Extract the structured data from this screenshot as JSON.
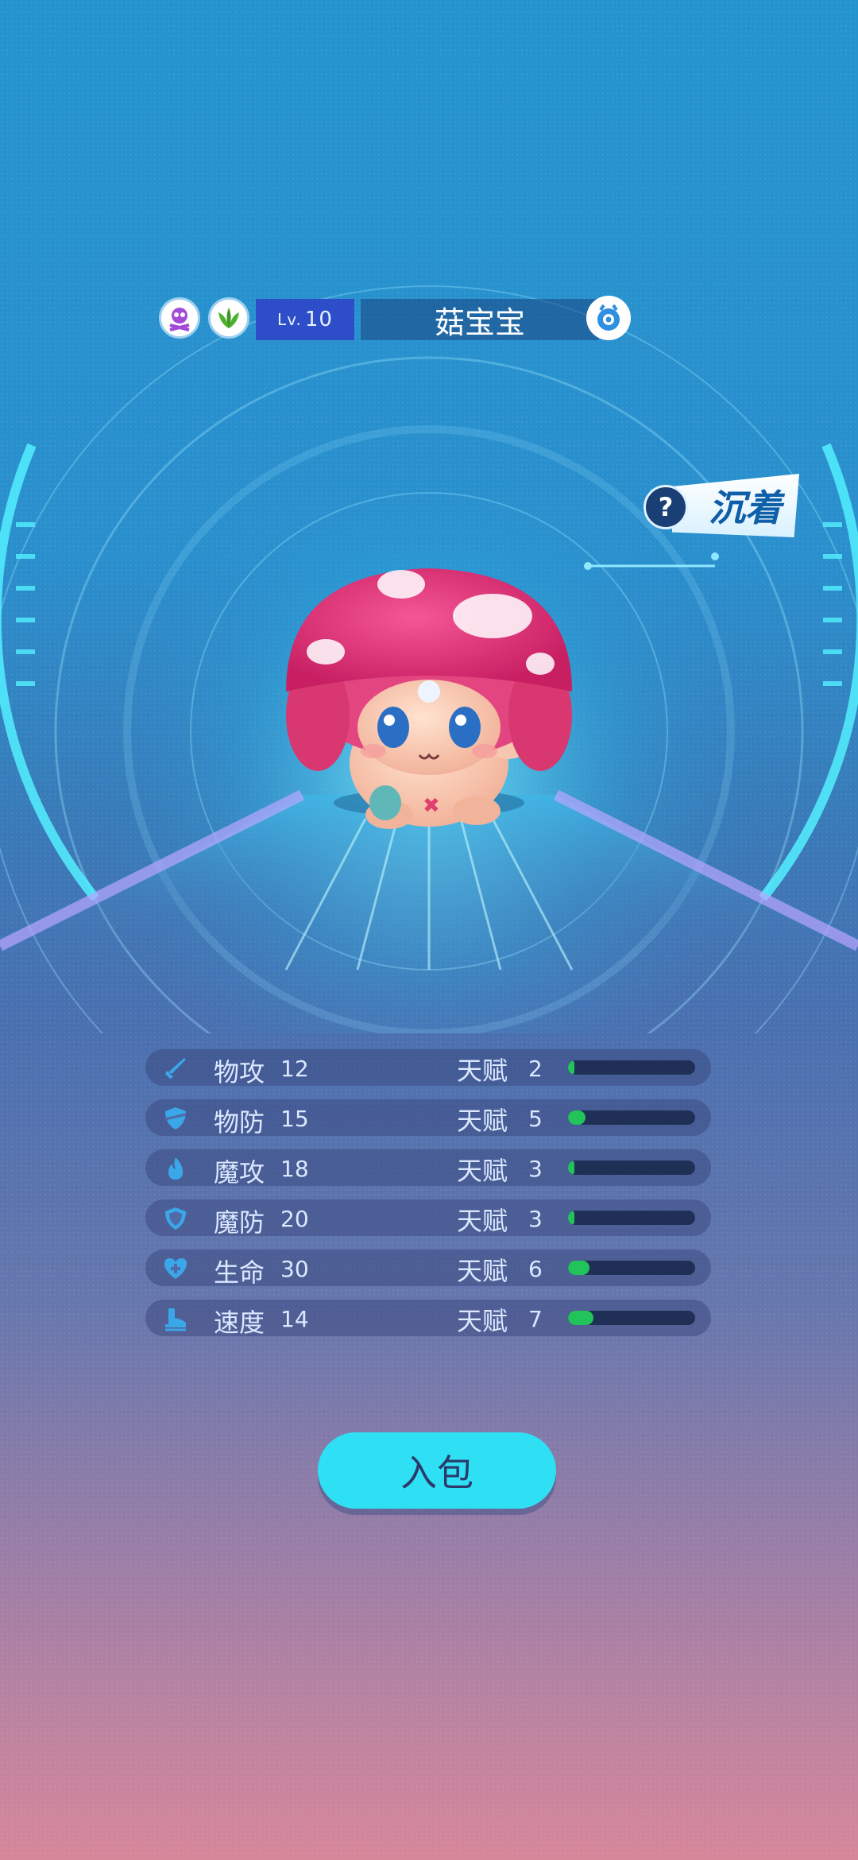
{
  "header": {
    "level_prefix": "Lv.",
    "level": "10",
    "pet_name": "菇宝宝",
    "type_badges": [
      "poison-skull-icon",
      "grass-leaf-icon"
    ],
    "gender_icon": "gender-icon"
  },
  "trait": {
    "label": "沉着",
    "help_symbol": "?"
  },
  "stats": [
    {
      "name": "物攻",
      "value": "12",
      "talent_label": "天赋",
      "talent": "2",
      "talent_fill": 0.05,
      "icon": "sword-icon"
    },
    {
      "name": "物防",
      "value": "15",
      "talent_label": "天赋",
      "talent": "5",
      "talent_fill": 0.14,
      "icon": "shield-icon"
    },
    {
      "name": "魔攻",
      "value": "18",
      "talent_label": "天赋",
      "talent": "3",
      "talent_fill": 0.05,
      "icon": "flame-icon"
    },
    {
      "name": "魔防",
      "value": "20",
      "talent_label": "天赋",
      "talent": "3",
      "talent_fill": 0.05,
      "icon": "magic-shield-icon"
    },
    {
      "name": "生命",
      "value": "30",
      "talent_label": "天赋",
      "talent": "6",
      "talent_fill": 0.17,
      "icon": "heart-plus-icon"
    },
    {
      "name": "速度",
      "value": "14",
      "talent_label": "天赋",
      "talent": "7",
      "talent_fill": 0.2,
      "icon": "boot-icon"
    }
  ],
  "bag_button": "入包",
  "colors": {
    "accent": "#2fe0f5",
    "level_bg": "#2e4dc8",
    "talent_bar": "#22c35b"
  }
}
